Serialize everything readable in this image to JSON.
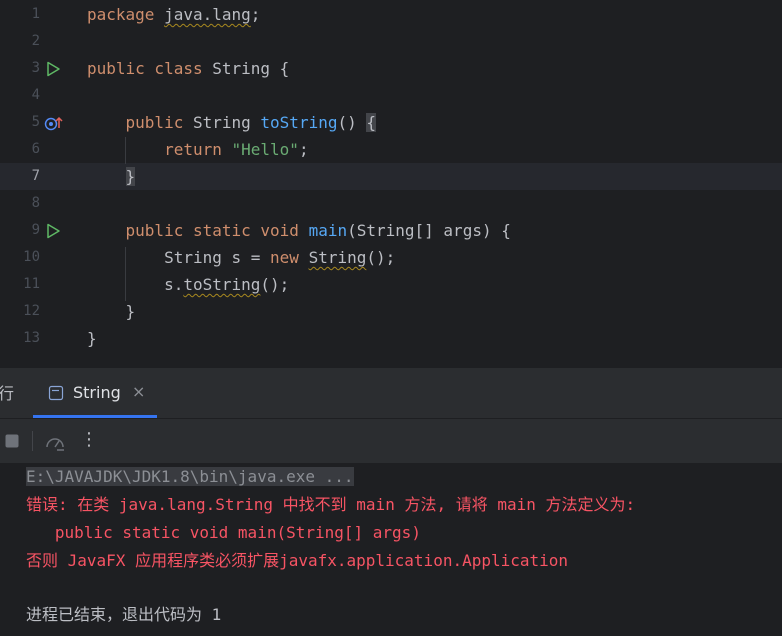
{
  "editor": {
    "lines": [
      {
        "num": "1",
        "segments": [
          {
            "text": "package ",
            "cls": "kw"
          },
          {
            "text": "java.lang",
            "cls": "pkg squig"
          },
          {
            "text": ";",
            "cls": ""
          }
        ]
      },
      {
        "num": "2",
        "segments": []
      },
      {
        "num": "3",
        "gutter": "run",
        "segments": [
          {
            "text": "public class ",
            "cls": "kw"
          },
          {
            "text": "String {",
            "cls": ""
          }
        ]
      },
      {
        "num": "4",
        "segments": []
      },
      {
        "num": "5",
        "gutter": "override",
        "segments": [
          {
            "text": "    public ",
            "cls": "kw"
          },
          {
            "text": "String ",
            "cls": ""
          },
          {
            "text": "toString",
            "cls": "fn"
          },
          {
            "text": "() ",
            "cls": ""
          },
          {
            "text": "{",
            "cls": "bh"
          }
        ]
      },
      {
        "num": "6",
        "segments": [
          {
            "text": "        return ",
            "cls": "kw"
          },
          {
            "text": "\"Hello\"",
            "cls": "str"
          },
          {
            "text": ";",
            "cls": ""
          }
        ]
      },
      {
        "num": "7",
        "current": true,
        "segments": [
          {
            "text": "    ",
            "cls": ""
          },
          {
            "text": "}",
            "cls": "bh"
          }
        ]
      },
      {
        "num": "8",
        "segments": []
      },
      {
        "num": "9",
        "gutter": "run",
        "segments": [
          {
            "text": "    public static void ",
            "cls": "kw"
          },
          {
            "text": "main",
            "cls": "fn"
          },
          {
            "text": "(String[] args) {",
            "cls": ""
          }
        ]
      },
      {
        "num": "10",
        "segments": [
          {
            "text": "        String s = ",
            "cls": ""
          },
          {
            "text": "new ",
            "cls": "kw"
          },
          {
            "text": "String",
            "cls": "squig"
          },
          {
            "text": "();",
            "cls": ""
          }
        ]
      },
      {
        "num": "11",
        "segments": [
          {
            "text": "        s.",
            "cls": ""
          },
          {
            "text": "toString",
            "cls": "squig"
          },
          {
            "text": "();",
            "cls": ""
          }
        ]
      },
      {
        "num": "12",
        "segments": [
          {
            "text": "    }",
            "cls": ""
          }
        ]
      },
      {
        "num": "13",
        "segments": [
          {
            "text": "}",
            "cls": ""
          }
        ]
      }
    ]
  },
  "run_panel": {
    "tab_cut_label": "行",
    "tab_label": "String",
    "tab_close": "×",
    "more_icon": "⋮"
  },
  "console": {
    "command": "E:\\JAVAJDK\\JDK1.8\\bin\\java.exe ...",
    "error_line1": "错误: 在类 java.lang.String 中找不到 main 方法, 请将 main 方法定义为:",
    "error_line2": "   public static void main(String[] args)",
    "error_line3": "否则 JavaFX 应用程序类必须扩展javafx.application.Application",
    "exit_line": "进程已结束，退出代码为 1"
  },
  "colors": {
    "background": "#1e1f22",
    "keyword": "#cf8e6d",
    "function": "#56a8f5",
    "string": "#6aab73",
    "error": "#f75464",
    "accent": "#3574f0"
  }
}
